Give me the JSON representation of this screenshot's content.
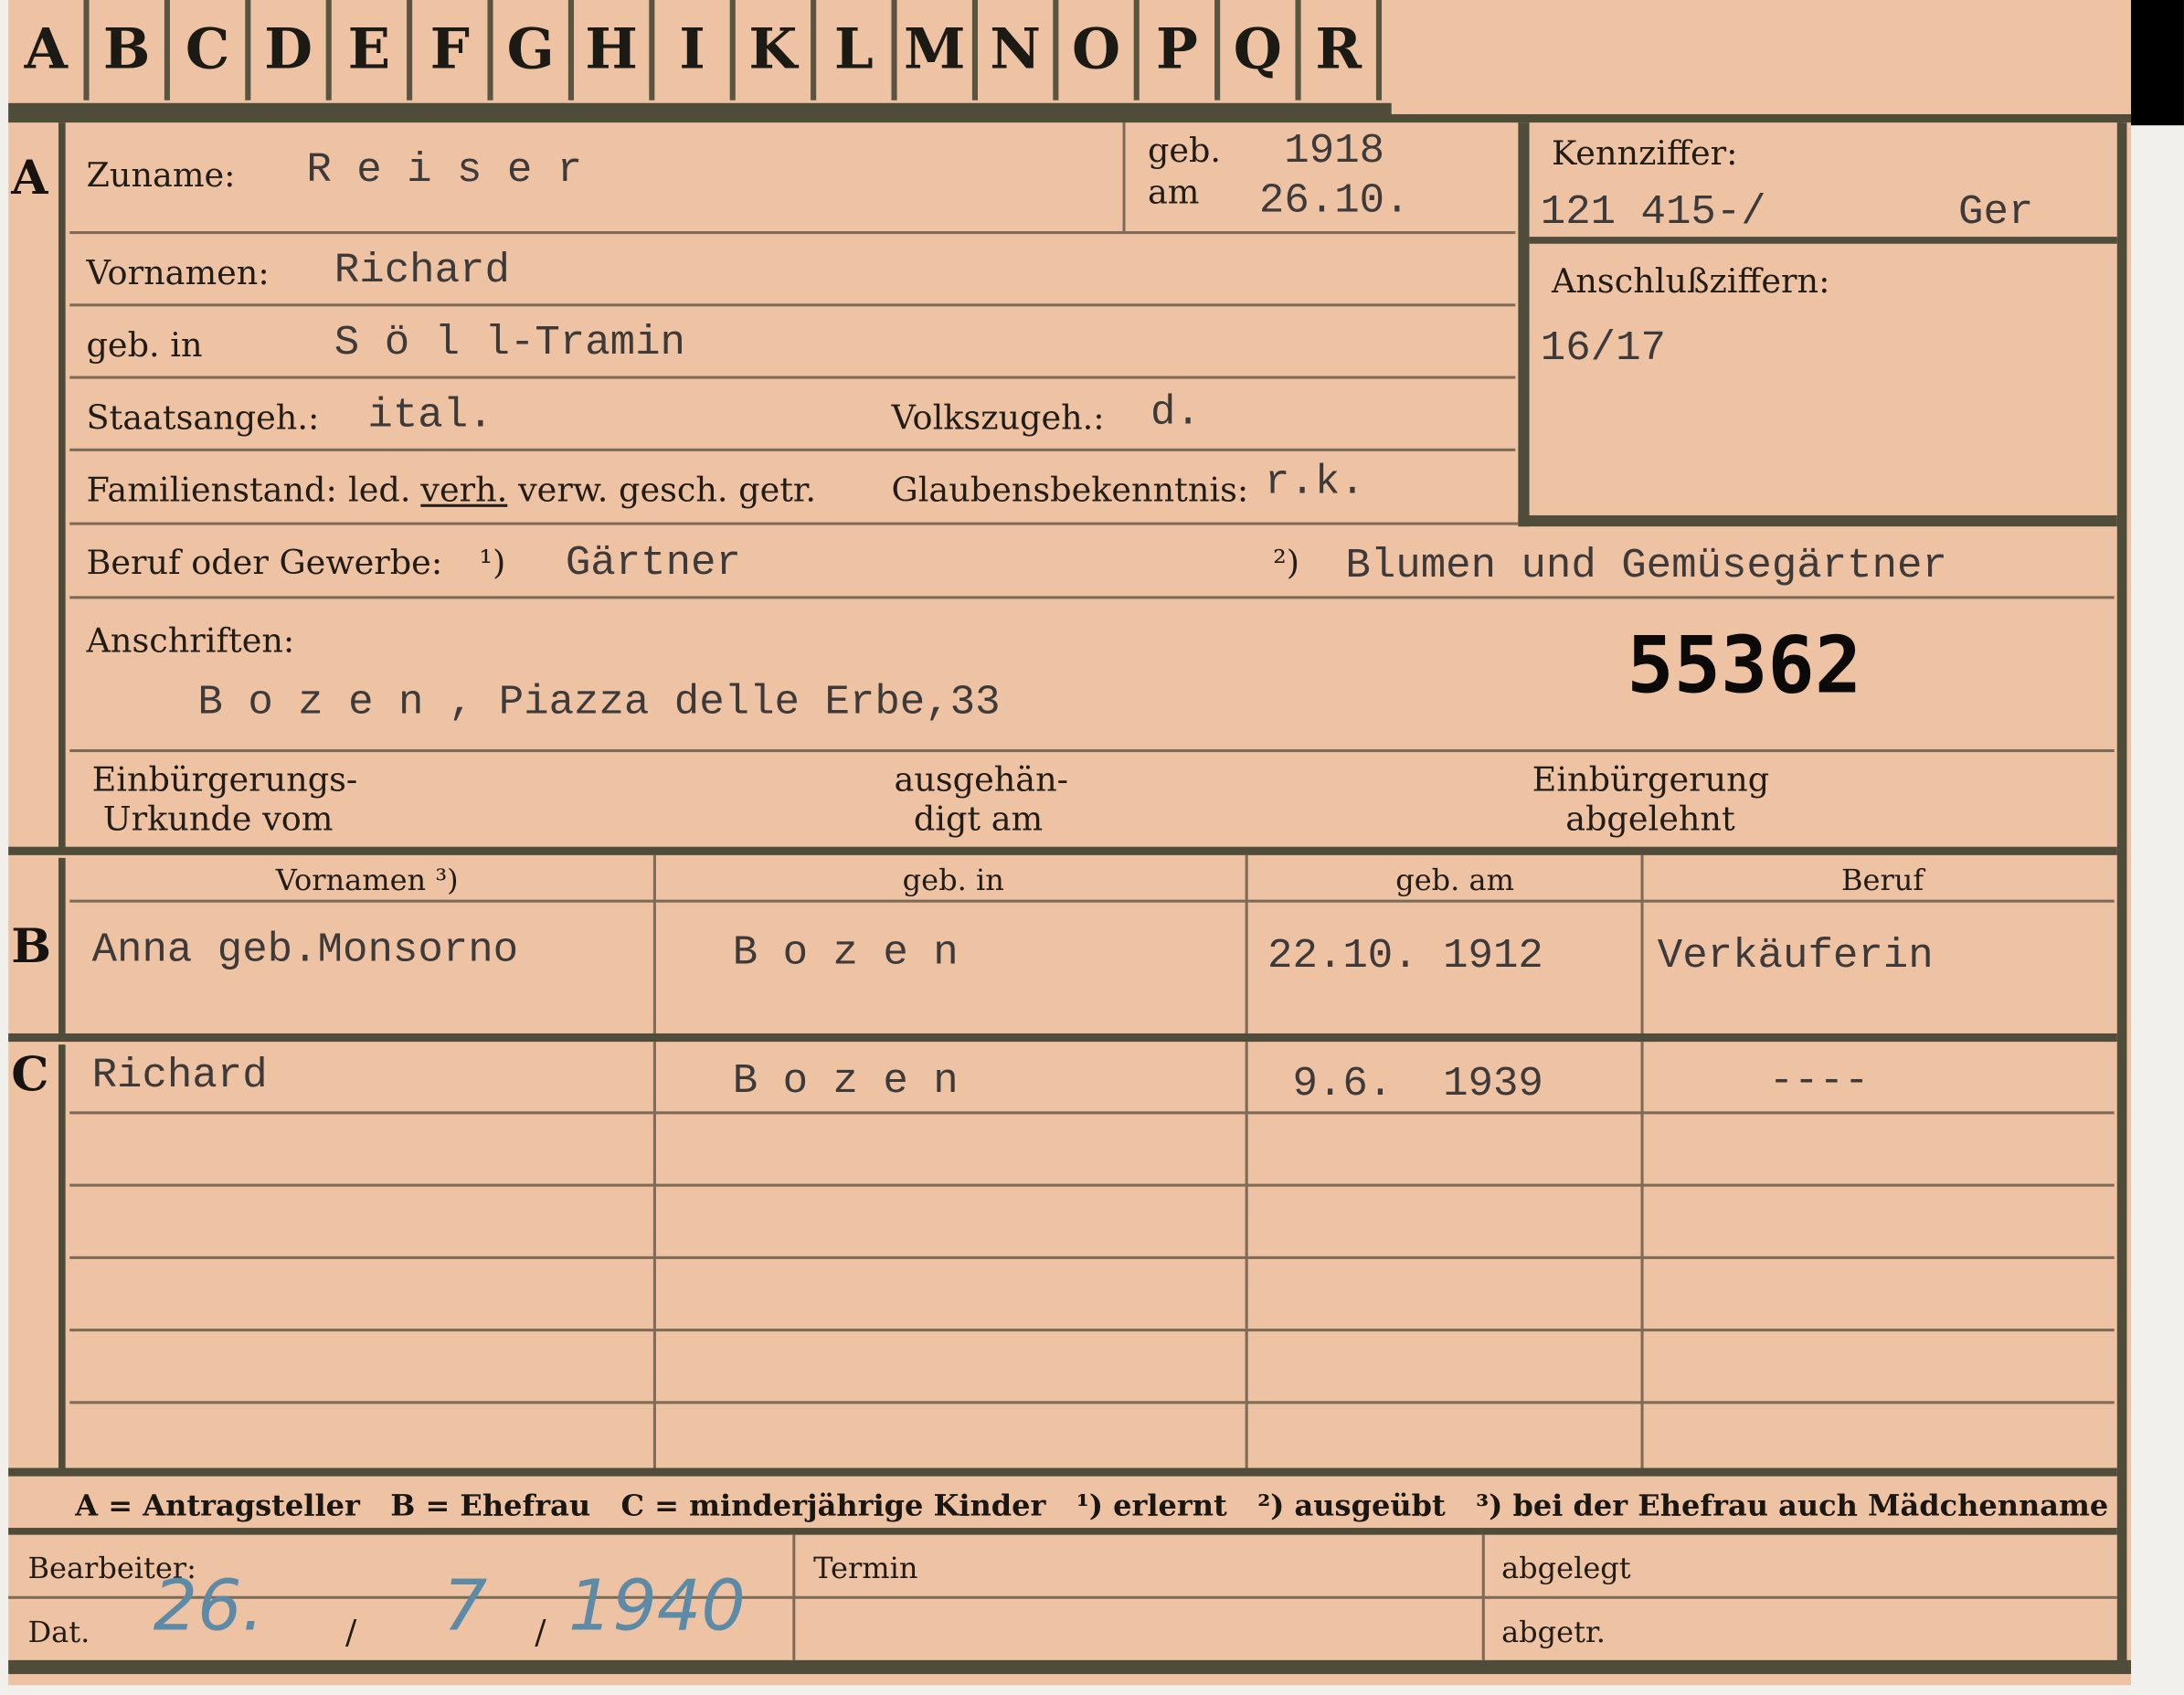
{
  "tabs": [
    "A",
    "B",
    "C",
    "D",
    "E",
    "F",
    "G",
    "H",
    "I",
    "K",
    "L",
    "M",
    "N",
    "O",
    "P",
    "Q",
    "R"
  ],
  "sections": {
    "a": "A",
    "b": "B",
    "c": "C"
  },
  "applicant": {
    "surname_label": "Zuname:",
    "surname": "R e i s e r",
    "born_label_1": "geb.",
    "born_label_2": "am",
    "birth_year": "1918",
    "birth_date": "26.10.",
    "firstnames_label": "Vornamen:",
    "firstnames": "Richard",
    "birthplace_label": "geb. in",
    "birthplace": "S ö l l-Tramin",
    "citizenship_label": "Staatsangeh.:",
    "citizenship": "ital.",
    "ethnicity_label": "Volkszugeh.:",
    "ethnicity": "d.",
    "marital_label": "Familienstand:",
    "marital_led": "led.",
    "marital_verh": "verh.",
    "marital_rest": "verw. gesch. getr.",
    "religion_label": "Glaubensbekenntnis:",
    "religion": "r.k.",
    "occupation_label": "Beruf oder Gewerbe:",
    "occ_note1": "¹)",
    "occupation_learned": "Gärtner",
    "occ_note2": "²)",
    "occupation_practiced": "Blumen und Gemüsegärtner",
    "address_label": "Anschriften:",
    "address": "B o z e n , Piazza delle Erbe,33",
    "file_number": "55362",
    "naturalization_certificate_1": "Einbürgerungs-",
    "naturalization_certificate_2": "Urkunde vom",
    "handed_out_1": "ausgehän-",
    "handed_out_2": "digt am",
    "naturalization_rejected_1": "Einbürgerung",
    "naturalization_rejected_2": "abgelehnt"
  },
  "id_box": {
    "kennziffer_label": "Kennziffer:",
    "kennziffer": "121 415-/",
    "kennziffer_suffix": "Ger",
    "anschluss_label": "Anschlußziffern:",
    "anschluss": "16/17"
  },
  "family_headers": [
    "Vornamen ³)",
    "geb. in",
    "geb. am",
    "Beruf"
  ],
  "wife": {
    "name": "Anna geb.Monsorno",
    "birthplace": "B o z e n",
    "birthdate": "22.10. 1912",
    "occupation": "Verkäuferin"
  },
  "children": [
    {
      "name": "Richard",
      "birthplace": "B o z e n",
      "birthdate": "9.6.  1939",
      "occupation": "----"
    }
  ],
  "legend": "A = Antragsteller   B = Ehefrau   C = minderjährige Kinder   ¹) erlernt   ²) ausgeübt   ³) bei der Ehefrau auch Mädchenname",
  "footer": {
    "processor_label": "Bearbeiter:",
    "date_label": "Dat.",
    "date_day": "26.",
    "date_sep": "/",
    "date_month": "7",
    "date_sep2": "/",
    "date_year": "1940",
    "deadline_label": "Termin",
    "filed_label": "abgelegt",
    "sent_label": "abgetr."
  }
}
